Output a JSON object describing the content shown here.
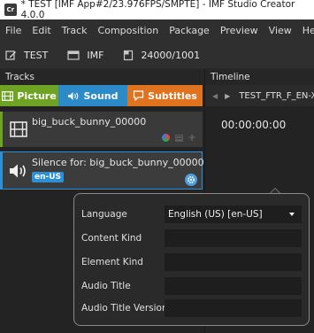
{
  "window": {
    "title": "* TEST [IMF App#2/23.976FPS/SMPTE] - IMF Studio Creator 4.0.0",
    "app_icon_text": "Cr"
  },
  "menu": [
    "File",
    "Edit",
    "Track",
    "Composition",
    "Package",
    "Preview",
    "View",
    "Help"
  ],
  "toolbar": {
    "composition_name": "TEST",
    "package_type": "IMF",
    "frame_rate": "24000/1001"
  },
  "tracks_panel": {
    "title": "Tracks",
    "tabs": [
      {
        "label": "Picture",
        "color": "#6ea323"
      },
      {
        "label": "Sound",
        "color": "#2c8ac8"
      },
      {
        "label": "Subtitles",
        "color": "#e07320"
      }
    ],
    "video_track": {
      "name": "big_buck_bunny_00000"
    },
    "audio_track": {
      "name": "Silence for: big_buck_bunny_00000",
      "language": "en-US"
    }
  },
  "timeline_panel": {
    "title": "Timeline",
    "sequence_name": "TEST_FTR_F_EN-X",
    "timecode": "00:00:00:00"
  },
  "properties_popup": {
    "fields": [
      {
        "label": "Language",
        "value": "English (US) [en-US]",
        "type": "dropdown"
      },
      {
        "label": "Content Kind",
        "value": ""
      },
      {
        "label": "Element Kind",
        "value": ""
      },
      {
        "label": "Audio Title",
        "value": ""
      },
      {
        "label": "Audio Title Version",
        "value": ""
      }
    ]
  }
}
